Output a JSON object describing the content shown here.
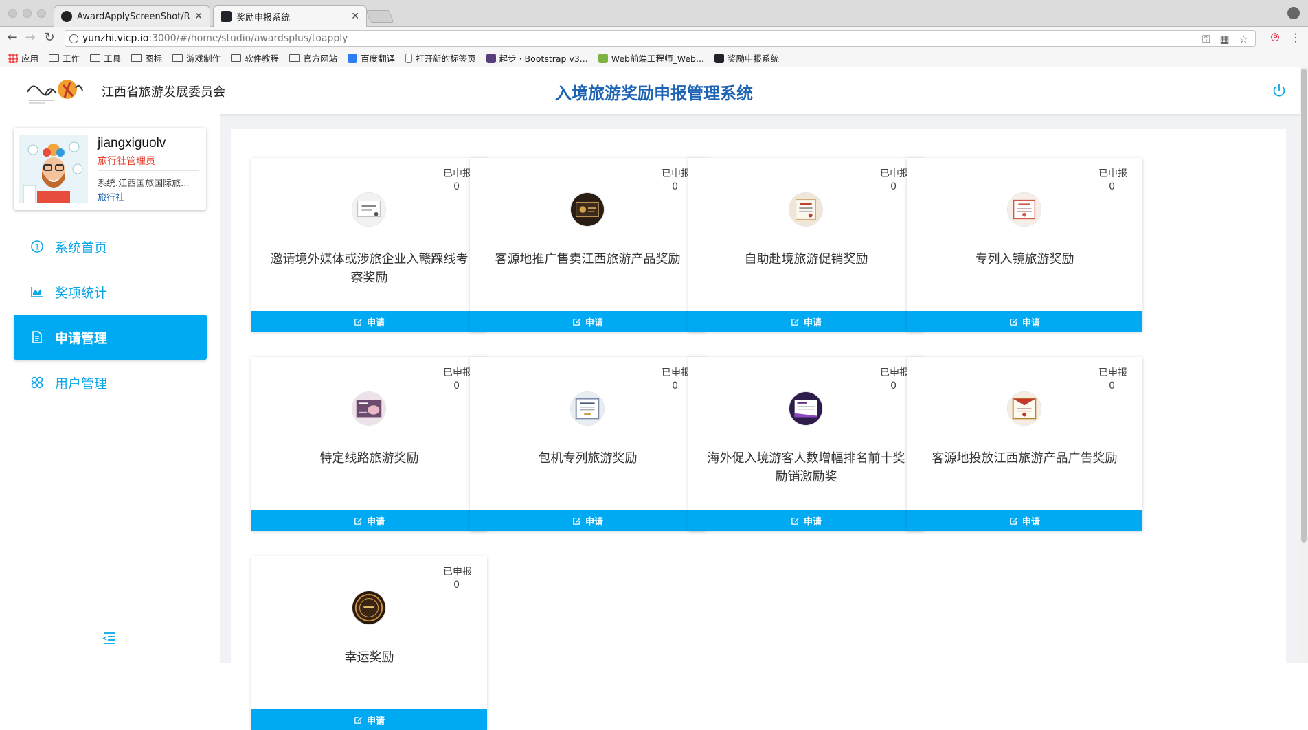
{
  "browser": {
    "tabs": [
      {
        "title": "AwardApplyScreenShot/READM",
        "active": false
      },
      {
        "title": "奖励申报系统",
        "active": true
      }
    ],
    "url_host": "yunzhi.vicp.io",
    "url_rest": ":3000/#/home/studio/awardsplus/toapply",
    "bookmarks": [
      {
        "label": "应用",
        "icon": "apps-grid-icon"
      },
      {
        "label": "工作",
        "icon": "folder-icon"
      },
      {
        "label": "工具",
        "icon": "folder-icon"
      },
      {
        "label": "图标",
        "icon": "folder-icon"
      },
      {
        "label": "游戏制作",
        "icon": "folder-icon"
      },
      {
        "label": "软件教程",
        "icon": "folder-icon"
      },
      {
        "label": "官方网站",
        "icon": "folder-icon"
      },
      {
        "label": "百度翻译",
        "icon": "baidu-translate-icon"
      },
      {
        "label": "打开新的标签页",
        "icon": "page-icon"
      },
      {
        "label": "起步 · Bootstrap v3...",
        "icon": "bootstrap-icon"
      },
      {
        "label": "Web前端工程师_Web...",
        "icon": "site-icon"
      },
      {
        "label": "奖励申报系统",
        "icon": "react-icon"
      }
    ]
  },
  "header": {
    "org_name": "江西省旅游发展委员会",
    "system_title": "入境旅游奖励申报管理系统",
    "accent": "#1e64b4"
  },
  "user": {
    "name": "jiangxiguolv",
    "role": "旅行社管理员",
    "org": "系统.江西国旅国际旅...",
    "type": "旅行社"
  },
  "menu": [
    {
      "label": "系统首页",
      "icon": "info-circle-icon",
      "active": false
    },
    {
      "label": "奖项统计",
      "icon": "area-chart-icon",
      "active": false
    },
    {
      "label": "申请管理",
      "icon": "document-icon",
      "active": true
    },
    {
      "label": "用户管理",
      "icon": "users-icon",
      "active": false
    }
  ],
  "awards": {
    "badge_label": "已申报",
    "apply_label": "申请",
    "items": [
      {
        "name": "邀请境外媒体或涉旅企业入赣踩线考察奖励",
        "count": "0"
      },
      {
        "name": "客源地推广售卖江西旅游产品奖励",
        "count": "0"
      },
      {
        "name": "自助赴境旅游促销奖励",
        "count": "0"
      },
      {
        "name": "专列入镜旅游奖励",
        "count": "0"
      },
      {
        "name": "特定线路旅游奖励",
        "count": "0"
      },
      {
        "name": "包机专列旅游奖励",
        "count": "0"
      },
      {
        "name": "海外促入境游客人数增幅排名前十奖励销激励奖",
        "count": "0"
      },
      {
        "name": "客源地投放江西旅游产品广告奖励",
        "count": "0"
      },
      {
        "name": "幸运奖励",
        "count": "0"
      }
    ]
  },
  "colors": {
    "primary": "#00aaf2",
    "role_red": "#e8412f"
  }
}
